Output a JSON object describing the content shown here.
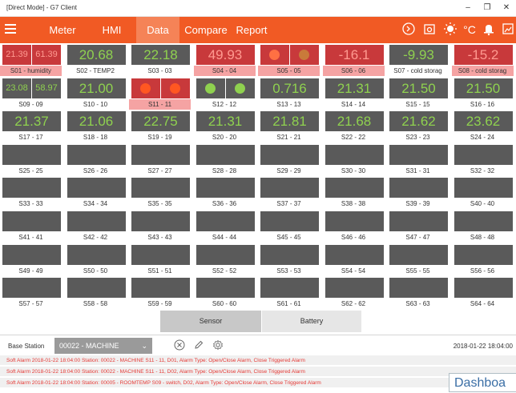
{
  "window": {
    "title": "[Direct Mode] - G7 Client",
    "minimize": "–",
    "maximize": "❐",
    "close": "✕"
  },
  "menu": {
    "items": [
      {
        "label": "Meter"
      },
      {
        "label": "HMI"
      },
      {
        "label": "Data"
      },
      {
        "label": "Compare"
      },
      {
        "label": "Report"
      }
    ],
    "temp_unit": "°C"
  },
  "sensors": [
    {
      "label": "S01 - humidity",
      "kind": "dual",
      "left": "21.39",
      "right": "61.39",
      "bg": "red",
      "label_bg": "pink"
    },
    {
      "label": "S02 - TEMP2",
      "kind": "value",
      "value": "20.68",
      "bg": "gray"
    },
    {
      "label": "S03 - 03",
      "kind": "value",
      "value": "22.18",
      "bg": "gray"
    },
    {
      "label": "S04 - 04",
      "kind": "value",
      "value": "49.93",
      "bg": "red",
      "label_bg": "pink"
    },
    {
      "label": "S05 - 05",
      "kind": "dots",
      "dot_left": "#ff7043",
      "dot_right": "#c97a3a",
      "bg": "red",
      "label_bg": "pink"
    },
    {
      "label": "S06 - 06",
      "kind": "value",
      "value": "-16.1",
      "bg": "red",
      "label_bg": "pink"
    },
    {
      "label": "S07 - cold storag",
      "kind": "value",
      "value": "-9.93",
      "bg": "gray"
    },
    {
      "label": "S08 - cold storag",
      "kind": "value",
      "value": "-15.2",
      "bg": "red",
      "label_bg": "pink"
    },
    {
      "label": "S09 - 09",
      "kind": "dual",
      "left": "23.08",
      "right": "58.97",
      "bg": "gray"
    },
    {
      "label": "S10 - 10",
      "kind": "value",
      "value": "21.00",
      "bg": "gray"
    },
    {
      "label": "S11 - 11",
      "kind": "dots",
      "dot_left": "#ff5722",
      "dot_right": "#ff5722",
      "bg": "red",
      "label_bg": "pink"
    },
    {
      "label": "S12 - 12",
      "kind": "dots",
      "dot_left": "#8fd14f",
      "dot_right": "#8fd14f",
      "bg": "gray"
    },
    {
      "label": "S13 - 13",
      "kind": "value",
      "value": "0.716",
      "bg": "gray"
    },
    {
      "label": "S14 - 14",
      "kind": "value",
      "value": "21.31",
      "bg": "gray"
    },
    {
      "label": "S15 - 15",
      "kind": "value",
      "value": "21.50",
      "bg": "gray"
    },
    {
      "label": "S16 - 16",
      "kind": "value",
      "value": "21.50",
      "bg": "gray"
    },
    {
      "label": "S17 - 17",
      "kind": "value",
      "value": "21.37",
      "bg": "gray"
    },
    {
      "label": "S18 - 18",
      "kind": "value",
      "value": "21.06",
      "bg": "gray"
    },
    {
      "label": "S19 - 19",
      "kind": "value",
      "value": "22.75",
      "bg": "gray"
    },
    {
      "label": "S20 - 20",
      "kind": "value",
      "value": "21.31",
      "bg": "gray"
    },
    {
      "label": "S21 - 21",
      "kind": "value",
      "value": "21.81",
      "bg": "gray"
    },
    {
      "label": "S22 - 22",
      "kind": "value",
      "value": "21.68",
      "bg": "gray"
    },
    {
      "label": "S23 - 23",
      "kind": "value",
      "value": "21.62",
      "bg": "gray"
    },
    {
      "label": "S24 - 24",
      "kind": "value",
      "value": "23.62",
      "bg": "gray"
    },
    {
      "label": "S25 - 25",
      "kind": "empty"
    },
    {
      "label": "S26 - 26",
      "kind": "empty"
    },
    {
      "label": "S27 - 27",
      "kind": "empty"
    },
    {
      "label": "S28 - 28",
      "kind": "empty"
    },
    {
      "label": "S29 - 29",
      "kind": "empty"
    },
    {
      "label": "S30 - 30",
      "kind": "empty"
    },
    {
      "label": "S31 - 31",
      "kind": "empty"
    },
    {
      "label": "S32 - 32",
      "kind": "empty"
    },
    {
      "label": "S33 - 33",
      "kind": "empty"
    },
    {
      "label": "S34 - 34",
      "kind": "empty"
    },
    {
      "label": "S35 - 35",
      "kind": "empty"
    },
    {
      "label": "S36 - 36",
      "kind": "empty"
    },
    {
      "label": "S37 - 37",
      "kind": "empty"
    },
    {
      "label": "S38 - 38",
      "kind": "empty"
    },
    {
      "label": "S39 - 39",
      "kind": "empty"
    },
    {
      "label": "S40 - 40",
      "kind": "empty"
    },
    {
      "label": "S41 - 41",
      "kind": "empty"
    },
    {
      "label": "S42 - 42",
      "kind": "empty"
    },
    {
      "label": "S43 - 43",
      "kind": "empty"
    },
    {
      "label": "S44 - 44",
      "kind": "empty"
    },
    {
      "label": "S45 - 45",
      "kind": "empty"
    },
    {
      "label": "S46 - 46",
      "kind": "empty"
    },
    {
      "label": "S47 - 47",
      "kind": "empty"
    },
    {
      "label": "S48 - 48",
      "kind": "empty"
    },
    {
      "label": "S49 - 49",
      "kind": "empty"
    },
    {
      "label": "S50 - 50",
      "kind": "empty"
    },
    {
      "label": "S51 - 51",
      "kind": "empty"
    },
    {
      "label": "S52 - 52",
      "kind": "empty"
    },
    {
      "label": "S53 - 53",
      "kind": "empty"
    },
    {
      "label": "S54 - 54",
      "kind": "empty"
    },
    {
      "label": "S55 - 55",
      "kind": "empty"
    },
    {
      "label": "S56 - 56",
      "kind": "empty"
    },
    {
      "label": "S57 - 57",
      "kind": "empty"
    },
    {
      "label": "S58 - 58",
      "kind": "empty"
    },
    {
      "label": "S59 - 59",
      "kind": "empty"
    },
    {
      "label": "S60 - 60",
      "kind": "empty"
    },
    {
      "label": "S61 - 61",
      "kind": "empty"
    },
    {
      "label": "S62 - 62",
      "kind": "empty"
    },
    {
      "label": "S63 - 63",
      "kind": "empty"
    },
    {
      "label": "S64 - 64",
      "kind": "empty"
    }
  ],
  "view_tabs": {
    "sensor": "Sensor",
    "battery": "Battery"
  },
  "footer": {
    "base_station_label": "Base Station",
    "base_station_value": "00022 - MACHINE",
    "timestamp": "2018-01-22 18:04:00"
  },
  "alarms": [
    "Soft Alarm   2018-01-22 18:04:00   Station: 00022 - MACHINE   S11 - 11, D01, Alarm Type: Open/Close Alarm, Close Triggered Alarm",
    "Soft Alarm   2018-01-22 18:04:00   Station: 00022 - MACHINE   S11 - 11, D02, Alarm Type: Open/Close Alarm, Close Triggered Alarm",
    "Soft Alarm   2018-01-22 18:04:00   Station: 00005 - ROOMTEMP   S09 - switch, D02, Alarm Type: Open/Close Alarm, Close Triggered Alarm"
  ],
  "dashboard_popup": "Dashboa"
}
